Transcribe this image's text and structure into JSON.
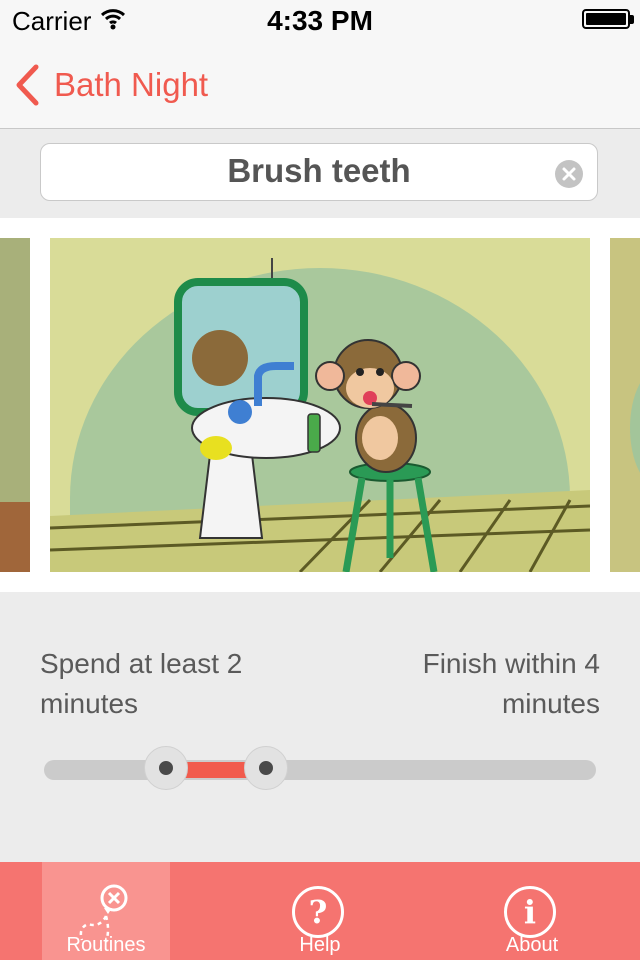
{
  "status_bar": {
    "carrier": "Carrier",
    "time": "4:33 PM"
  },
  "nav": {
    "back_label": "Bath Night"
  },
  "task": {
    "title": "Brush teeth"
  },
  "timing": {
    "min_label": "Spend at least 2 minutes",
    "max_label": "Finish within 4 minutes",
    "min_minutes": 2,
    "max_minutes": 4
  },
  "tabs": [
    {
      "label": "Routines",
      "icon": "routines-map-icon",
      "selected": true
    },
    {
      "label": "Help",
      "icon": "help-icon",
      "glyph": "?",
      "selected": false
    },
    {
      "label": "About",
      "icon": "info-icon",
      "glyph": "i",
      "selected": false
    }
  ],
  "colors": {
    "accent": "#f05a4f",
    "tab_bar": "#f57470",
    "tab_selected": "#f99490"
  }
}
